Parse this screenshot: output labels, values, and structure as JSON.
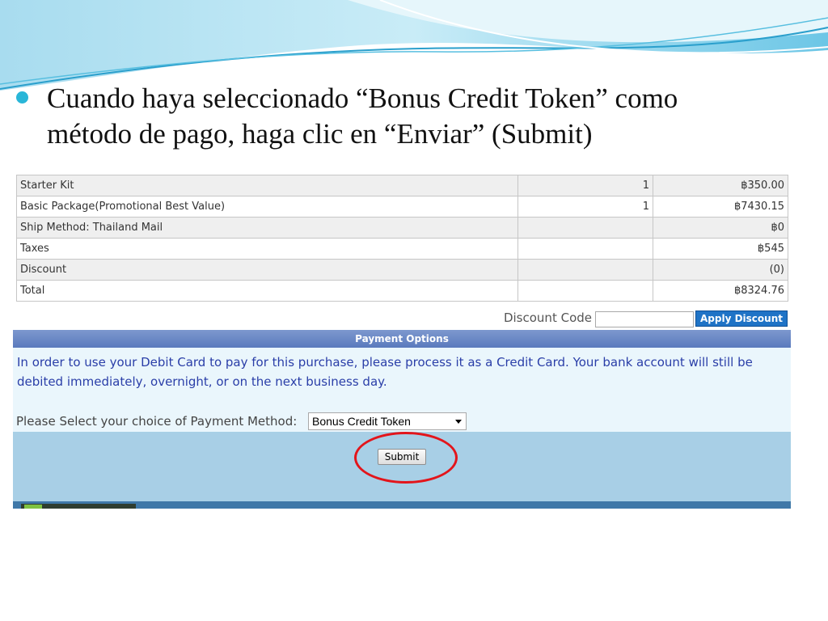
{
  "slide": {
    "text_line1": "Cuando haya seleccionado “Bonus Credit Token” como",
    "text_line2": "método de pago, haga clic en “Enviar” (Submit)"
  },
  "order_table": {
    "rows": [
      {
        "item": "Starter Kit",
        "qty": "1",
        "amount": "฿350.00"
      },
      {
        "item": "Basic Package(Promotional Best Value)",
        "qty": "1",
        "amount": "฿7430.15"
      },
      {
        "item": "Ship Method: Thailand Mail",
        "qty": "",
        "amount": "฿0"
      },
      {
        "item": "Taxes",
        "qty": "",
        "amount": "฿545"
      },
      {
        "item": "Discount",
        "qty": "",
        "amount": "(0)"
      },
      {
        "item": "Total",
        "qty": "",
        "amount": "฿8324.76"
      }
    ]
  },
  "discount": {
    "label": "Discount Code",
    "value": "",
    "apply_label": "Apply Discount"
  },
  "payment": {
    "header": "Payment Options",
    "note": "In order to use your Debit Card to pay for this purchase, please process it as a Credit Card. Your bank account will still be debited immediately, overnight, or on the next business day.",
    "method_label": "Please Select your choice of Payment Method:",
    "method_selected": "Bonus Credit Token",
    "submit_label": "Submit"
  },
  "colors": {
    "accent": "#29b6d8",
    "highlight_circle": "#e3151b",
    "header_bar": "#5a7abd",
    "apply_button": "#1f73c6"
  }
}
